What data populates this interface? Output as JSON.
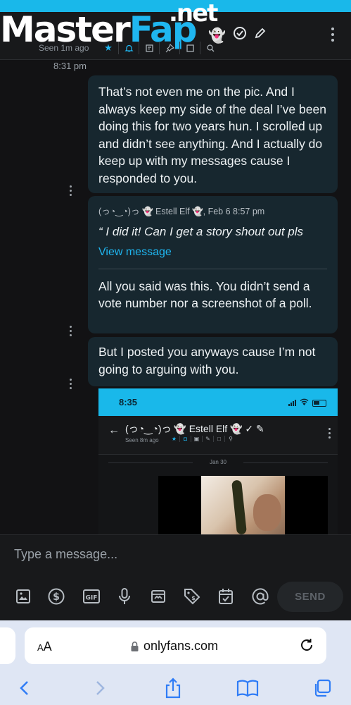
{
  "watermark": {
    "master": "Master",
    "fap": "Fap",
    "net": ".net"
  },
  "header": {
    "seen": "Seen 1m ago",
    "icons": [
      "star-icon",
      "bell-icon",
      "notes-icon",
      "pin-icon",
      "media-icon",
      "search-icon"
    ]
  },
  "chat": {
    "time": "8:31 pm",
    "msg1": "That’s not even me on the pic. And I always keep my side of the deal I’ve been doing this for two years hun. I scrolled up and didn’t see anything. And I actually do keep up with my messages cause I responded to you.",
    "quote": {
      "author": "(っ◔‿◔)っ 👻 Estell Elf 👻, Feb 6 8:57 pm",
      "text": "“ I did it! Can I get a story shout out pls",
      "link": "View message"
    },
    "reply2": "All you said was this. You didn’t send a vote number nor a screenshot of a poll.",
    "msg3": "But I posted you anyways cause I’m not going to arguing with you."
  },
  "embedded": {
    "time": "8:35",
    "name": "(っ◔‿◔)っ 👻 Estell Elf 👻 ✓ ✎",
    "seen": "Seen 8m ago",
    "date": "Jan 30"
  },
  "composer": {
    "placeholder": "Type a message...",
    "send_label": "SEND",
    "tools": [
      "image-icon",
      "dollar-icon",
      "gif-icon",
      "microphone-icon",
      "vault-icon",
      "price-tag-icon",
      "calendar-check-icon",
      "at-icon"
    ]
  },
  "browser": {
    "aa_label": "AA",
    "url": "onlyfans.com"
  }
}
